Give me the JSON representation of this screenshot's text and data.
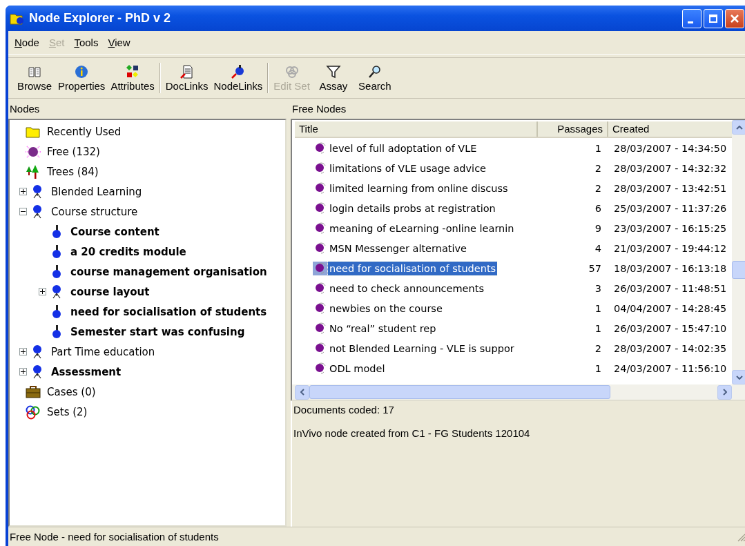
{
  "window": {
    "title": "Node Explorer - PhD v 2"
  },
  "menu": [
    {
      "label": "Node",
      "disabled": false
    },
    {
      "label": "Set",
      "disabled": true
    },
    {
      "label": "Tools",
      "disabled": false
    },
    {
      "label": "View",
      "disabled": false
    }
  ],
  "toolbar": [
    {
      "buttons": [
        {
          "label": "Browse",
          "kind": "book",
          "disabled": false
        },
        {
          "label": "Properties",
          "kind": "info",
          "disabled": false
        },
        {
          "label": "Attributes",
          "kind": "shapes",
          "disabled": false
        }
      ]
    },
    {
      "buttons": [
        {
          "label": "DocLinks",
          "kind": "doclink",
          "disabled": false
        },
        {
          "label": "NodeLinks",
          "kind": "nodelink",
          "disabled": false
        }
      ]
    },
    {
      "buttons": [
        {
          "label": "Edit Set",
          "kind": "rings",
          "disabled": true
        },
        {
          "label": "Assay",
          "kind": "funnel",
          "disabled": false
        },
        {
          "label": "Search",
          "kind": "search",
          "disabled": false
        }
      ]
    }
  ],
  "nodes_pane": {
    "header": "Nodes",
    "tree": [
      {
        "label": "Recently Used",
        "kind": "folder",
        "bold": false
      },
      {
        "label": "Free (132)",
        "kind": "free",
        "bold": false
      },
      {
        "label": "Trees (84)",
        "kind": "trees",
        "bold": false,
        "children": [
          {
            "label": "Blended Learning",
            "kind": "branch",
            "bold": false,
            "expanded": false
          },
          {
            "label": "Course structure",
            "kind": "branch",
            "bold": false,
            "expanded": true,
            "children": [
              {
                "label": "Course content",
                "kind": "leaf",
                "bold": true
              },
              {
                "label": "a 20 credits module",
                "kind": "leaf",
                "bold": true
              },
              {
                "label": "course management organisation",
                "kind": "leaf",
                "bold": true
              },
              {
                "label": "course layout",
                "kind": "branch",
                "bold": true,
                "expanded": false
              },
              {
                "label": "need for socialisation of students",
                "kind": "leaf",
                "bold": true
              },
              {
                "label": "Semester start was confusing",
                "kind": "leaf",
                "bold": true
              }
            ]
          },
          {
            "label": "Part Time education",
            "kind": "branch",
            "bold": false,
            "expanded": false
          },
          {
            "label": "Assessment",
            "kind": "branch",
            "bold": true,
            "expanded": false
          }
        ]
      },
      {
        "label": "Cases (0)",
        "kind": "cases",
        "bold": false
      },
      {
        "label": "Sets (2)",
        "kind": "sets",
        "bold": false
      }
    ]
  },
  "free_nodes_pane": {
    "header": "Free Nodes",
    "table": {
      "columns": [
        "Title",
        "Passages",
        "Created"
      ],
      "rows": [
        {
          "title": "level of full adoptation of VLE",
          "passages": "1",
          "created": "28/03/2007 - 14:34:50",
          "selected": false
        },
        {
          "title": "limitations of VLE usage advice",
          "passages": "2",
          "created": "28/03/2007 - 14:32:32",
          "selected": false
        },
        {
          "title": "limited learning from online discuss",
          "passages": "2",
          "created": "28/03/2007 - 13:42:51",
          "selected": false
        },
        {
          "title": "login details probs at registration",
          "passages": "6",
          "created": "25/03/2007 - 11:37:26",
          "selected": false
        },
        {
          "title": "meaning of eLearning -online learnin",
          "passages": "9",
          "created": "23/03/2007 - 16:15:25",
          "selected": false
        },
        {
          "title": "MSN Messenger alternative",
          "passages": "4",
          "created": "21/03/2007 - 19:44:12",
          "selected": false
        },
        {
          "title": "need for socialisation of students",
          "passages": "57",
          "created": "18/03/2007 - 16:13:18",
          "selected": true
        },
        {
          "title": "need to check announcements",
          "passages": "3",
          "created": "26/03/2007 - 11:48:51",
          "selected": false
        },
        {
          "title": "newbies on the course",
          "passages": "1",
          "created": "04/04/2007 - 14:28:45",
          "selected": false
        },
        {
          "title": "No “real” student rep",
          "passages": "1",
          "created": "26/03/2007 - 15:47:10",
          "selected": false
        },
        {
          "title": "not Blended Learning - VLE is suppor",
          "passages": "2",
          "created": "28/03/2007 - 14:02:35",
          "selected": false
        },
        {
          "title": "ODL model",
          "passages": "1",
          "created": "24/03/2007 - 11:56:10",
          "selected": false
        }
      ]
    },
    "details": [
      "Documents coded: 17",
      "InVivo node created from C1 - FG Students 120104"
    ]
  },
  "status_bar": "Free Node - need for socialisation of students"
}
